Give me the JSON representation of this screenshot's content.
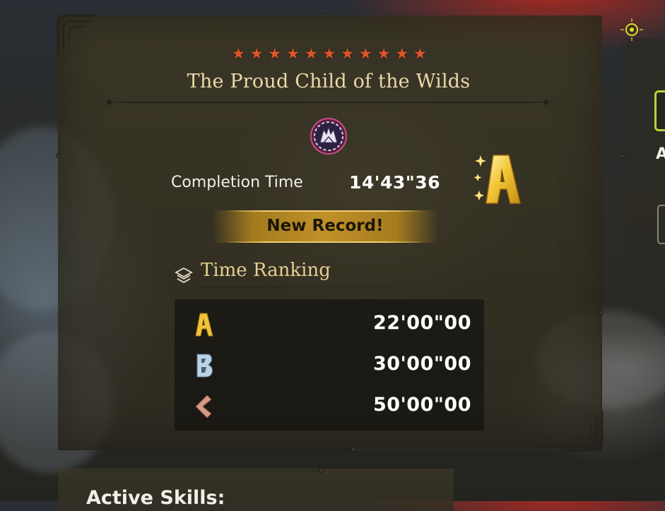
{
  "quest": {
    "star_count": 11,
    "star_color": "#e2542c",
    "title": "The Proud Child of the Wilds",
    "monster_icon": "monster-portrait-icon"
  },
  "completion": {
    "label": "Completion Time",
    "value": "14'43\"36",
    "rank": "A",
    "record_text": "New Record!"
  },
  "ranking": {
    "heading": "Time Ranking",
    "rows": [
      {
        "rank": "A",
        "time": "22'00\"00",
        "color": "#f0c23a"
      },
      {
        "rank": "B",
        "time": "30'00\"00",
        "color": "#b9d3e6"
      },
      {
        "rank": "C",
        "time": "50'00\"00",
        "color": "#d49a86"
      }
    ]
  },
  "bottom": {
    "active_skills_label": "Active Skills:"
  },
  "right_panel": {
    "letter": "A"
  }
}
